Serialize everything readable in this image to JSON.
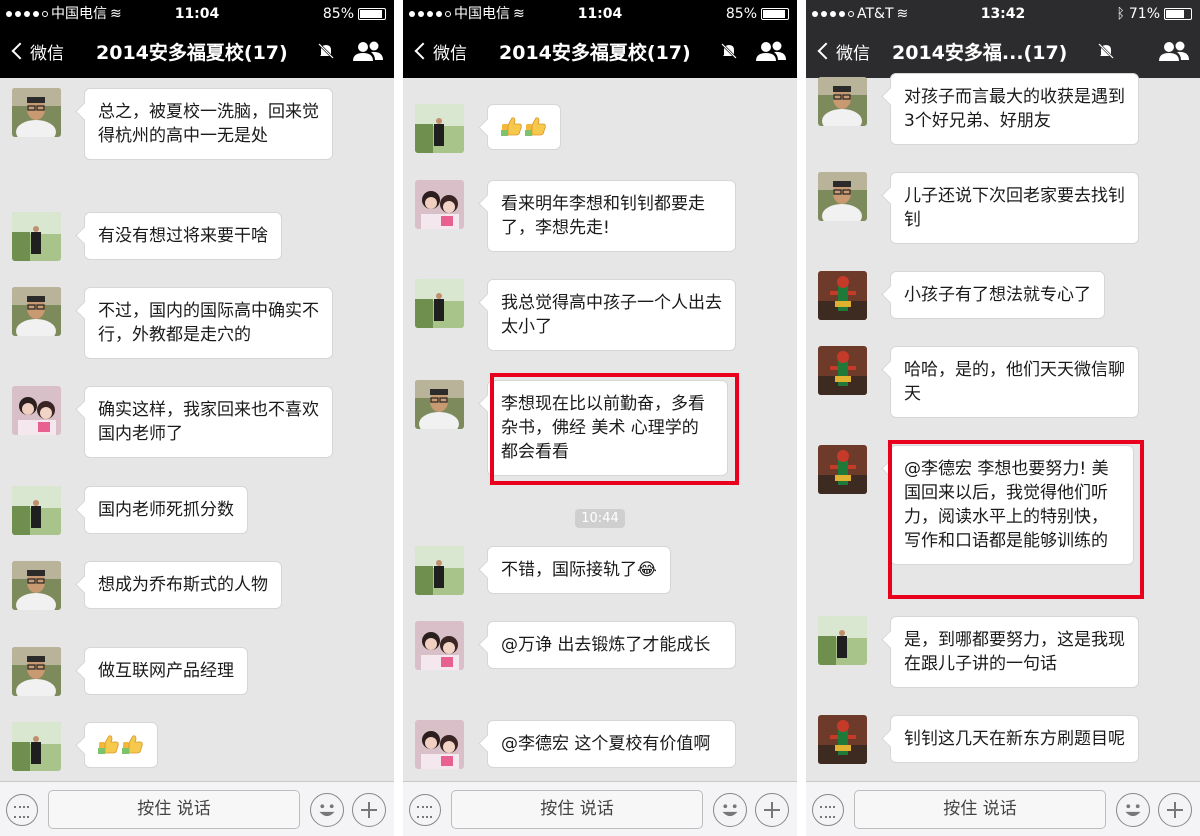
{
  "accent_color": "#e8001c",
  "phones": [
    {
      "status": {
        "carrier": "中国电信",
        "time": "11:04",
        "battery": "85%"
      },
      "nav": {
        "back_label": "微信",
        "title": "2014安多福夏校(17)"
      },
      "messages": [
        {
          "text": "总之，被夏校一洗脑，回来觉得杭州的高中一无是处"
        },
        {
          "text": "有没有想过将来要干啥"
        },
        {
          "text": "不过，国内的国际高中确实不行，外教都是走穴的"
        },
        {
          "text": "确实这样，我家回来也不喜欢国内老师了"
        },
        {
          "text": "国内老师死抓分数"
        },
        {
          "text": "想成为乔布斯式的人物"
        },
        {
          "text": "做互联网产品经理"
        },
        {
          "emoji": "thumbs-up-icon x2"
        }
      ],
      "input": {
        "talk_label": "按住 说话"
      }
    },
    {
      "status": {
        "carrier": "中国电信",
        "time": "11:04",
        "battery": "85%"
      },
      "nav": {
        "back_label": "微信",
        "title": "2014安多福夏校(17)"
      },
      "messages": [
        {
          "emoji": "thumbs-up-icon x2"
        },
        {
          "text": "看来明年李想和钊钊都要走了，李想先走!"
        },
        {
          "text": "我总觉得高中孩子一个人出去太小了"
        },
        {
          "text": "李想现在比以前勤奋，多看杂书，佛经 美术 心理学的都会看看",
          "highlighted": true
        },
        {
          "text": "不错，国际接轨了"
        },
        {
          "text": "@万诤 出去锻炼了才能成长"
        },
        {
          "text": "@李德宏 这个夏校有价值啊"
        }
      ],
      "timestamp": "10:44",
      "input": {
        "talk_label": "按住 说话"
      }
    },
    {
      "status": {
        "carrier": "AT&T",
        "time": "13:42",
        "battery": "71%"
      },
      "nav": {
        "back_label": "微信",
        "title": "2014安多福...(17)"
      },
      "messages": [
        {
          "text": "对孩子而言最大的收获是遇到3个好兄弟、好朋友"
        },
        {
          "text": "儿子还说下次回老家要去找钊钊"
        },
        {
          "text": "小孩子有了想法就专心了"
        },
        {
          "text": "哈哈，是的，他们天天微信聊天"
        },
        {
          "text": "@李德宏 李想也要努力! 美国回来以后，我觉得他们听力，阅读水平上的特别快，写作和口语都是能够训练的",
          "highlighted": true
        },
        {
          "text": "是，到哪都要努力，这是我现在跟儿子讲的一句话"
        },
        {
          "text": "钊钊这几天在新东方刷题目呢"
        }
      ],
      "input": {
        "talk_label": "按住 说话"
      }
    }
  ]
}
